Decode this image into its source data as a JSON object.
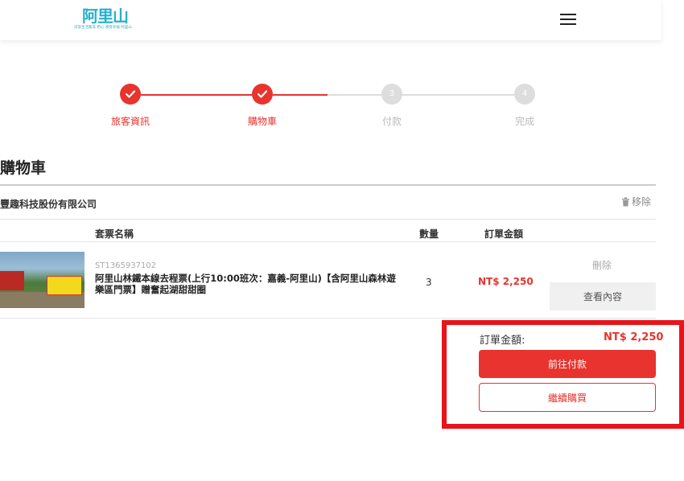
{
  "header": {
    "logo_text": "阿里山",
    "logo_tagline": "日常生活無非 用心 感受幸福  阿里山"
  },
  "stepper": {
    "steps": [
      {
        "label": "旅客資訊",
        "number": "1",
        "state": "done"
      },
      {
        "label": "購物車",
        "number": "2",
        "state": "done"
      },
      {
        "label": "付款",
        "number": "3",
        "state": "todo"
      },
      {
        "label": "完成",
        "number": "4",
        "state": "todo"
      }
    ]
  },
  "cart": {
    "title": "購物車",
    "vendor": "豐趣科技股份有限公司",
    "remove_all_label": "移除",
    "columns": {
      "name": "套票名稱",
      "qty": "數量",
      "amount": "訂單金額"
    },
    "items": [
      {
        "sku": "ST1365937102",
        "name": "阿里山林鐵本線去程票(上行10:00班次：嘉義-阿里山)【含阿里山森林遊樂區門票】贈奮起湖甜甜圈",
        "qty": "3",
        "price": "NT$ 2,250",
        "delete_label": "刪除",
        "view_label": "查看內容"
      }
    ]
  },
  "summary": {
    "total_label": "訂單金額:",
    "total_value": "NT$ 2,250",
    "pay_label": "前往付款",
    "continue_label": "繼續購買"
  },
  "colors": {
    "accent": "#e8332e",
    "highlight_border": "#e8141a",
    "inactive": "#dddddd"
  }
}
